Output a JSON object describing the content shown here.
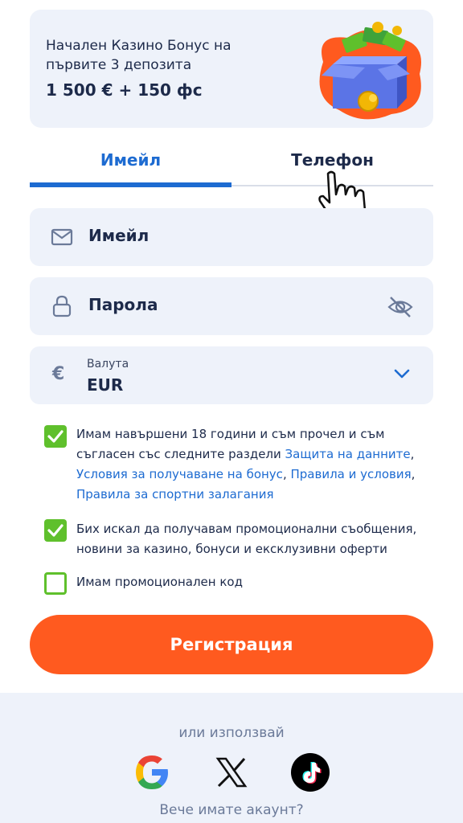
{
  "bonus": {
    "title": "Начален Казино Бонус на първите 3 депозита",
    "amount": "1 500 € + 150 фс"
  },
  "tabs": [
    {
      "label": "Имейл",
      "active": true
    },
    {
      "label": "Телефон",
      "active": false
    }
  ],
  "form": {
    "email_placeholder": "Имейл",
    "password_placeholder": "Парола",
    "currency_label": "Валута",
    "currency_value": "EUR",
    "currency_symbol": "€"
  },
  "consents": {
    "age": {
      "checked": true,
      "text_before": "Имам навършени 18 години и съм прочел и съм съгласен със следните раздели ",
      "link1": "Защита на данните",
      "sep1": ", ",
      "link2": "Условия за получаване на бонус",
      "sep2": ", ",
      "link3": "Правила и условия",
      "sep3": ", ",
      "link4": "Правила за спортни залагания"
    },
    "promo_messages": {
      "checked": true,
      "text": "Бих искал да получавам промоционални съобщения, новини за казино, бонуси и ексклузивни оферти"
    },
    "promo_code": {
      "checked": false,
      "text": "Имам промоционален код"
    }
  },
  "register_label": "Регистрация",
  "footer": {
    "or_use": "или използвай",
    "have_account": "Вече имате акаунт?"
  },
  "colors": {
    "accent": "#1d6bd1",
    "primary_button": "#ff5a1f",
    "check": "#5fc02c",
    "field_bg": "#eef2fa",
    "text": "#1d2a4a"
  }
}
